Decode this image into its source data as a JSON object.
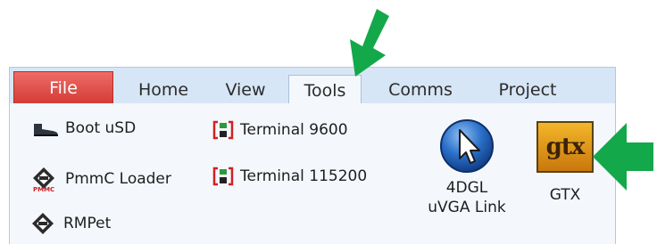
{
  "tabs": {
    "file": "File",
    "home": "Home",
    "view": "View",
    "tools": "Tools",
    "comms": "Comms",
    "project": "Project"
  },
  "tools_panel": {
    "boot_usd": "Boot uSD",
    "pmmc_loader": "PmmC Loader",
    "rmpet": "RMPet",
    "terminal_9600": "Terminal 9600",
    "terminal_115200": "Terminal 115200",
    "link_line1": "4DGL",
    "link_line2": "uVGA Link",
    "gtx": "GTX",
    "gtx_logo_text": "gtx"
  },
  "colors": {
    "file_tab": "#e04a44",
    "ribbon_bg": "#d7e6f6",
    "panel_bg": "#f4f8fd",
    "annotation_arrow": "#13a84a"
  },
  "icons": {
    "boot": "boot-icon",
    "pmmc": "chip-icon",
    "rmpet": "diamond-icon",
    "terminal": "terminal-icon",
    "link": "cursor-circle-icon",
    "gtx": "gtx-logo-icon",
    "annotation": "green-arrow-icon"
  }
}
